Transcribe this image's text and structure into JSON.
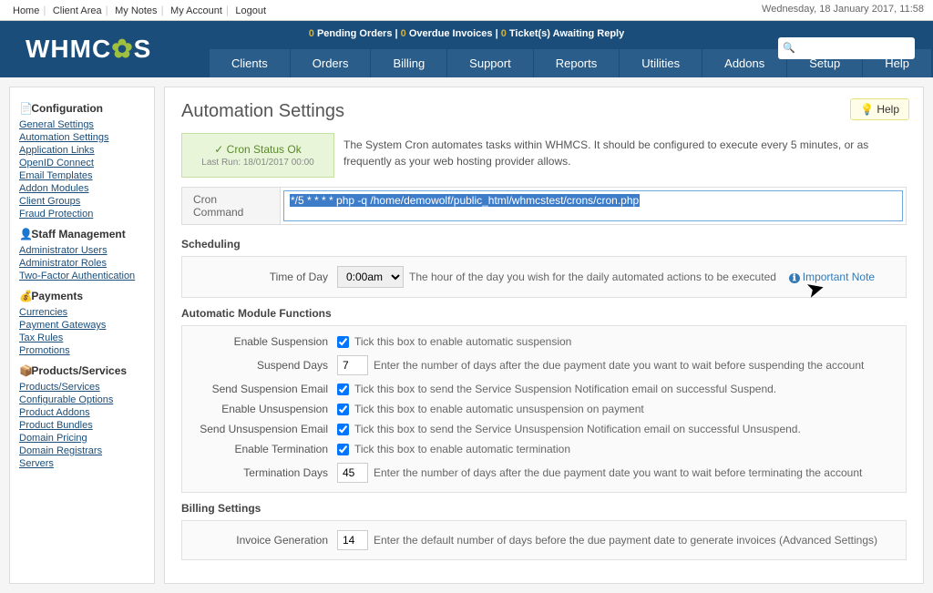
{
  "topnav": {
    "home": "Home",
    "clientarea": "Client Area",
    "mynotes": "My Notes",
    "myaccount": "My Account",
    "logout": "Logout"
  },
  "datetime": "Wednesday, 18 January 2017, 11:58",
  "brand": {
    "prefix": "WHMC",
    "suffix": "S"
  },
  "statusbar": {
    "pending_n": "0",
    "pending": " Pending Orders | ",
    "overdue_n": "0",
    "overdue": " Overdue Invoices | ",
    "tickets_n": "0",
    "tickets": " Ticket(s) Awaiting Reply"
  },
  "mainnav": {
    "clients": "Clients",
    "orders": "Orders",
    "billing": "Billing",
    "support": "Support",
    "reports": "Reports",
    "utilities": "Utilities",
    "addons": "Addons",
    "setup": "Setup",
    "help": "Help"
  },
  "sidebar": {
    "config_h": "Configuration",
    "config": [
      "General Settings",
      "Automation Settings",
      "Application Links",
      "OpenID Connect",
      "Email Templates",
      "Addon Modules",
      "Client Groups",
      "Fraud Protection"
    ],
    "staff_h": "Staff Management",
    "staff": [
      "Administrator Users",
      "Administrator Roles",
      "Two-Factor Authentication"
    ],
    "pay_h": "Payments",
    "pay": [
      "Currencies",
      "Payment Gateways",
      "Tax Rules",
      "Promotions"
    ],
    "prod_h": "Products/Services",
    "prod": [
      "Products/Services",
      "Configurable Options",
      "Product Addons",
      "Product Bundles",
      "Domain Pricing",
      "Domain Registrars",
      "Servers"
    ]
  },
  "page": {
    "title": "Automation Settings",
    "help": "Help",
    "cron_ok": "✓ Cron Status Ok",
    "cron_lastrun": "Last Run: 18/01/2017 00:00",
    "intro": "The System Cron automates tasks within WHMCS. It should be configured to execute every 5 minutes, or as frequently as your web hosting provider allows.",
    "cmd_label": "Cron Command",
    "cmd_value": "*/5 * * * * php -q /home/demowolf/public_html/whmcstest/crons/cron.php",
    "sched_h": "Scheduling",
    "sched_row": {
      "label": "Time of Day",
      "value": "0:00am",
      "desc": "The hour of the day you wish for the daily automated actions to be executed",
      "note": "Important Note"
    },
    "auto_h": "Automatic Module Functions",
    "auto": {
      "susp_l": "Enable Suspension",
      "susp_d": "Tick this box to enable automatic suspension",
      "suspd_l": "Suspend Days",
      "suspd_v": "7",
      "suspd_d": "Enter the number of days after the due payment date you want to wait before suspending the account",
      "suspe_l": "Send Suspension Email",
      "suspe_d": "Tick this box to send the Service Suspension Notification email on successful Suspend.",
      "unsusp_l": "Enable Unsuspension",
      "unsusp_d": "Tick this box to enable automatic unsuspension on payment",
      "unsuspe_l": "Send Unsuspension Email",
      "unsuspe_d": "Tick this box to send the Service Unsuspension Notification email on successful Unsuspend.",
      "term_l": "Enable Termination",
      "term_d": "Tick this box to enable automatic termination",
      "termd_l": "Termination Days",
      "termd_v": "45",
      "termd_d": "Enter the number of days after the due payment date you want to wait before terminating the account"
    },
    "bill_h": "Billing Settings",
    "bill": {
      "inv_l": "Invoice Generation",
      "inv_v": "14",
      "inv_d": "Enter the default number of days before the due payment date to generate invoices (Advanced Settings)"
    }
  }
}
